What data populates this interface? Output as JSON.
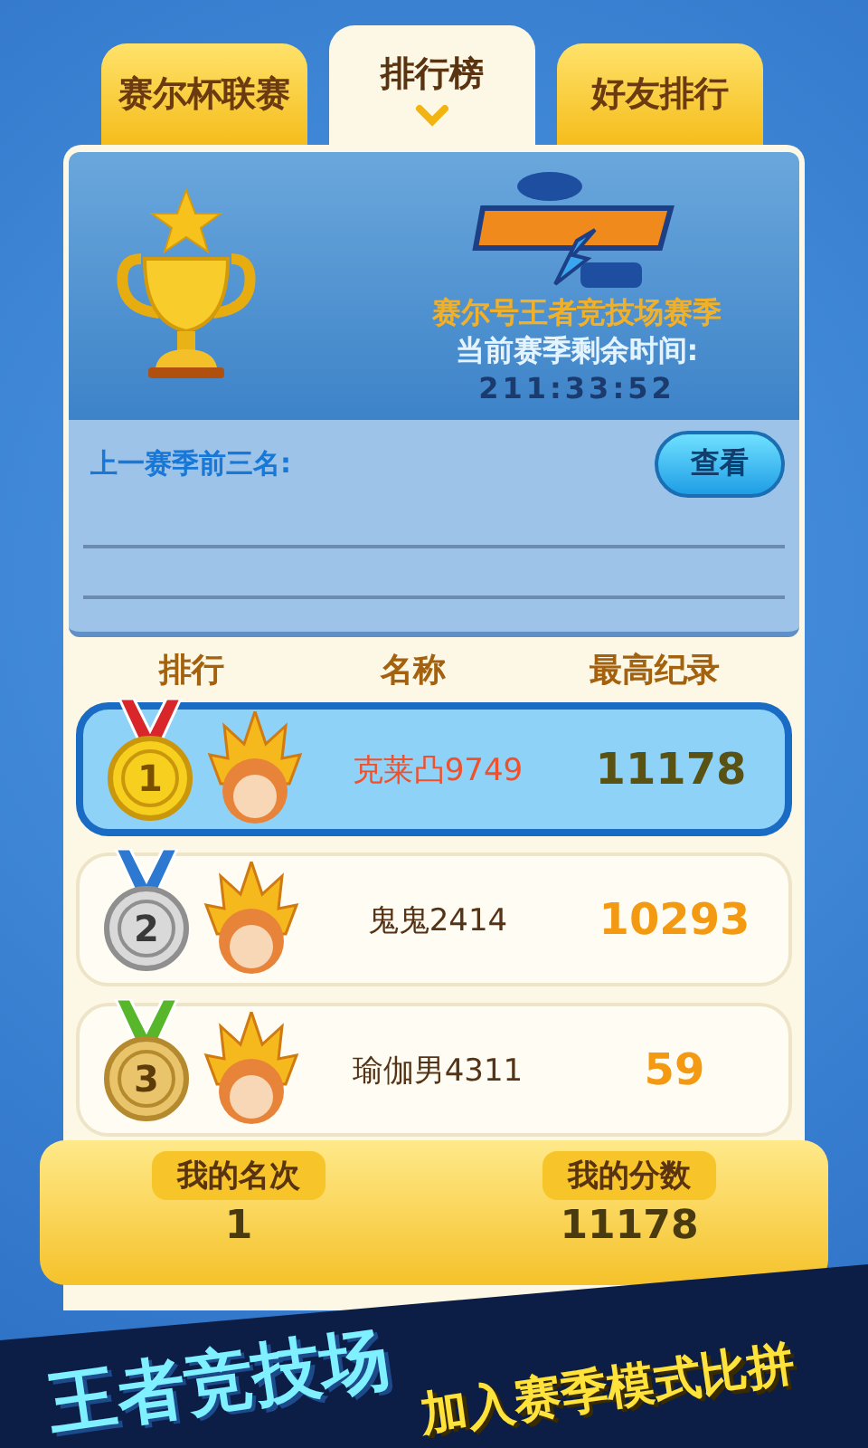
{
  "tabs": [
    {
      "label": "赛尔杯联赛",
      "selected": false
    },
    {
      "label": "排行榜",
      "selected": true
    },
    {
      "label": "好友排行",
      "selected": false
    }
  ],
  "season": {
    "title": "赛尔号王者竞技场赛季",
    "countdown_label": "当前赛季剩余时间:",
    "countdown": "211:33:52"
  },
  "previous": {
    "label": "上一赛季前三名:",
    "button": "查看"
  },
  "columns": [
    "排行",
    "名称",
    "最高纪录"
  ],
  "rows": [
    {
      "rank": "1",
      "kind": "gold",
      "name": "克莱凸9749",
      "score": "11178",
      "selected": true
    },
    {
      "rank": "2",
      "kind": "silver",
      "name": "鬼鬼2414",
      "score": "10293",
      "selected": false
    },
    {
      "rank": "3",
      "kind": "bronze",
      "name": "瑜伽男4311",
      "score": "59",
      "selected": false
    }
  ],
  "mine": [
    {
      "label": "我的名次",
      "value": "1"
    },
    {
      "label": "我的分数",
      "value": "11178"
    }
  ],
  "banner": {
    "title": "王者竞技场",
    "subtitle": "加入赛季模式比拼"
  }
}
